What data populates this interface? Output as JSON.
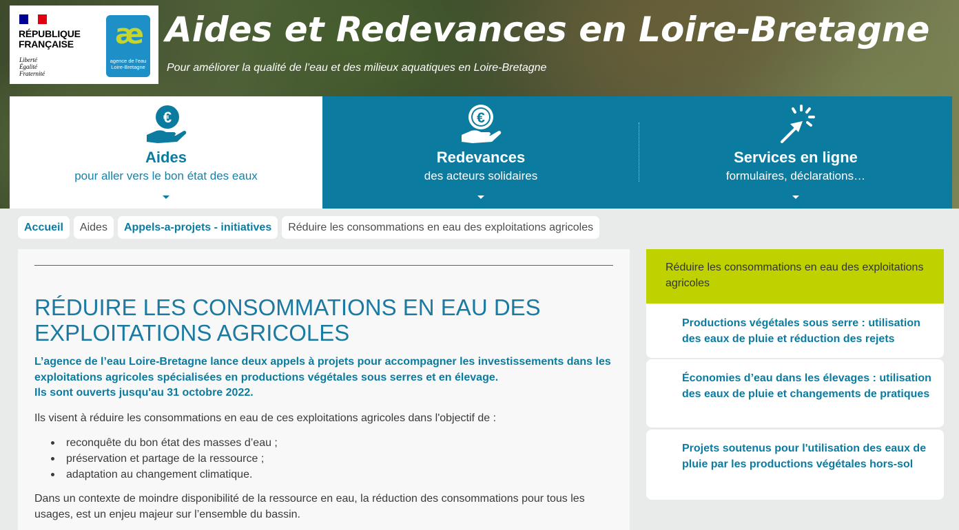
{
  "header": {
    "republique": {
      "title": "RÉPUBLIQUE\nFRANÇAISE",
      "motto": "Liberté\nÉgalité\nFraternité",
      "flag_colors": [
        "#000091",
        "#ffffff",
        "#e1000f"
      ]
    },
    "agency_logo": {
      "mark": "æ",
      "caption": "agence de l'eau\nLoire-Bretagne"
    },
    "title": "Aides et Redevances en Loire-Bretagne",
    "subtitle": "Pour améliorer la qualité de l’eau et des milieux aquatiques en Loire-Bretagne"
  },
  "nav": [
    {
      "label": "Aides",
      "sub": "pour aller vers le bon état des eaux",
      "icon": "euro-hand-icon",
      "active": true
    },
    {
      "label": "Redevances",
      "sub": "des acteurs solidaires",
      "icon": "euro-coin-hand-icon",
      "active": false
    },
    {
      "label": "Services en ligne",
      "sub": "formulaires, déclarations…",
      "icon": "cursor-click-icon",
      "active": false
    }
  ],
  "breadcrumb": [
    {
      "label": "Accueil",
      "link": true
    },
    {
      "label": "Aides",
      "link": false
    },
    {
      "label": "Appels-a-projets - initiatives",
      "link": true
    },
    {
      "label": "Réduire les consommations en eau des exploitations agricoles",
      "link": false
    }
  ],
  "main": {
    "title": "RÉDUIRE LES CONSOMMATIONS EN EAU DES EXPLOITATIONS AGRICOLES",
    "lead": "L’agence de l’eau Loire-Bretagne lance deux appels à projets pour accompagner les investissements dans les exploitations agricoles spécialisées en productions végétales sous serres et en élevage.",
    "lead_date": "Ils sont ouverts jusqu'au 31 octobre 2022.",
    "intro": "Ils visent à réduire les consommations en eau de ces exploitations agricoles dans l'objectif de :",
    "bullets": [
      "reconquête du bon état des masses d’eau ;",
      "préservation et partage de la ressource ;",
      "adaptation au changement climatique."
    ],
    "context": "Dans un contexte de moindre disponibilité de la ressource en eau, la réduction des consommations pour tous les usages, est un enjeu majeur sur l’ensemble du bassin."
  },
  "sidebar": {
    "heading": "Réduire les consommations en eau des exploitations agricoles",
    "items": [
      "Productions végétales sous serre : utilisation des eaux de pluie et réduction des rejets",
      "Économies d’eau dans les élevages : utilisation des eaux de pluie et changements de pratiques",
      "Projets soutenus pour l'utilisation des eaux de pluie par les productions végétales hors-sol"
    ]
  },
  "colors": {
    "brand_blue": "#0b7ba0",
    "sidebar_green": "#bfd200",
    "agency_blue": "#1f8fc7",
    "agency_green": "#c5d52f"
  }
}
